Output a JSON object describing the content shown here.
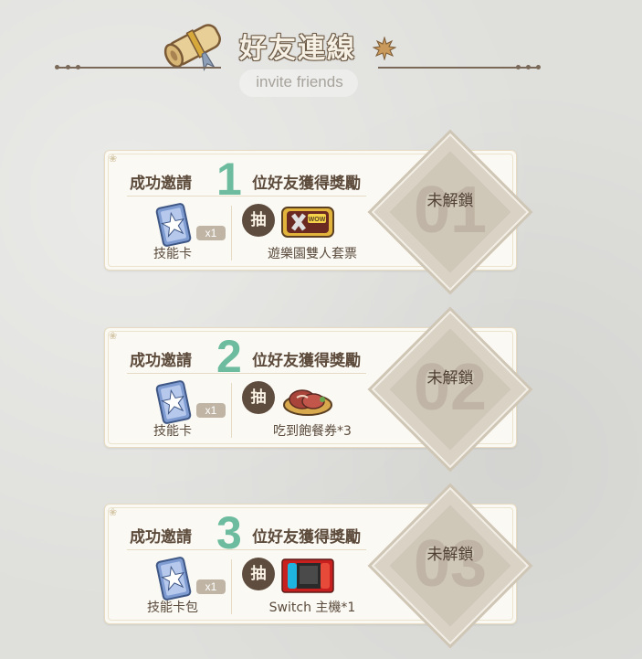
{
  "header": {
    "title": "好友連線",
    "subtitle": "invite friends",
    "icons": [
      "scroll-icon",
      "maple-leaf-icon"
    ]
  },
  "cards": [
    {
      "title_prefix": "成功邀請",
      "count": "1",
      "title_suffix": "位好友獲得獎勵",
      "base_reward": {
        "label": "技能卡",
        "qty": "x1",
        "icon": "skill-card-icon"
      },
      "draw_label": "抽",
      "prize": {
        "label": "遊樂園雙人套票",
        "icon": "amusement-park-ticket-icon"
      },
      "lock": {
        "number": "01",
        "status": "未解鎖"
      }
    },
    {
      "title_prefix": "成功邀請",
      "count": "2",
      "title_suffix": "位好友獲得獎勵",
      "base_reward": {
        "label": "技能卡",
        "qty": "x1",
        "icon": "skill-card-icon"
      },
      "draw_label": "抽",
      "prize": {
        "label": "吃到飽餐券*3",
        "icon": "buffet-meat-icon"
      },
      "lock": {
        "number": "02",
        "status": "未解鎖"
      }
    },
    {
      "title_prefix": "成功邀請",
      "count": "3",
      "title_suffix": "位好友獲得獎勵",
      "base_reward": {
        "label": "技能卡包",
        "qty": "x1",
        "icon": "skill-card-icon"
      },
      "draw_label": "抽",
      "prize": {
        "label": "Switch 主機*1",
        "icon": "nintendo-switch-icon"
      },
      "lock": {
        "number": "03",
        "status": "未解鎖"
      }
    }
  ],
  "colors": {
    "accent_number": "#6dbc9f",
    "text_dark": "#5c4a3b",
    "draw_badge": "#5e4c3f",
    "lock_fill": "#d9d2c5"
  }
}
